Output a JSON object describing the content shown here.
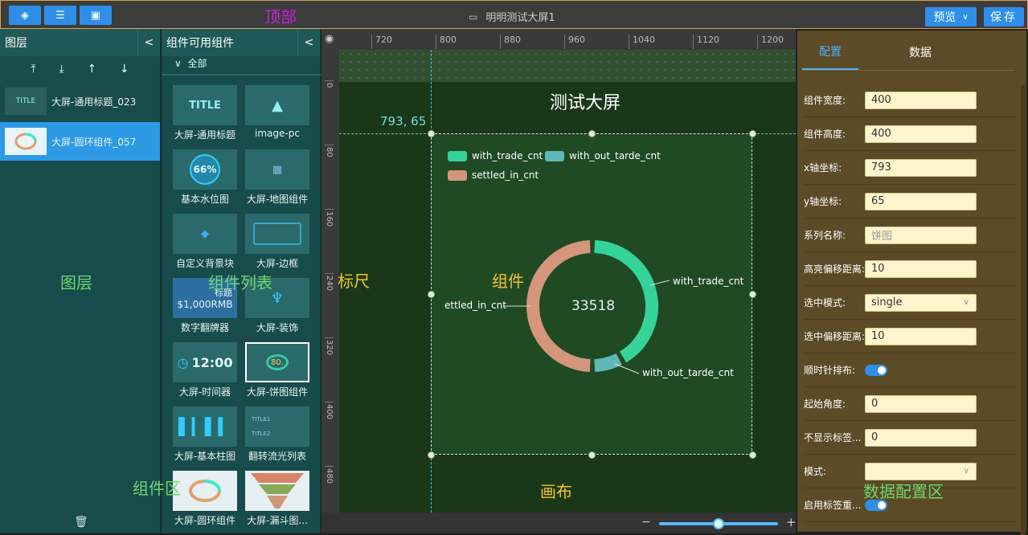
{
  "topbar": {
    "title": "明明测试大屏1",
    "preview": "预览",
    "save": "保存",
    "annotation": "顶部"
  },
  "layers": {
    "title": "图层",
    "items": [
      "大屏-通用标题_023",
      "大屏-圆环组件_057"
    ],
    "annotation": "图层",
    "thumb_title": "TITLE"
  },
  "components": {
    "title": "组件可用组件",
    "group": "全部",
    "annotation_list": "组件列表",
    "annotation_area": "组件区",
    "items": [
      {
        "label": "大屏-通用标题",
        "thumb": "TITLE"
      },
      {
        "label": "image-pc",
        "thumb": ""
      },
      {
        "label": "基本水位图",
        "thumb": "66%"
      },
      {
        "label": "大屏-地图组件",
        "thumb": ""
      },
      {
        "label": "自定义背景块",
        "thumb": ""
      },
      {
        "label": "大屏-边框",
        "thumb": ""
      },
      {
        "label": "数字翻牌器",
        "thumb": "$1,000RMB",
        "thumb_small": "标题"
      },
      {
        "label": "大屏-装饰",
        "thumb": ""
      },
      {
        "label": "大屏-时间器",
        "thumb": "12:00"
      },
      {
        "label": "大屏-饼图组件",
        "thumb": "80."
      },
      {
        "label": "大屏-基本柱图",
        "thumb": ""
      },
      {
        "label": "翻转流光列表",
        "thumb": "TITLE1",
        "thumb_small": "TITLE2"
      },
      {
        "label": "大屏-圆环组件",
        "thumb": ""
      },
      {
        "label": "大屏-漏斗图...",
        "thumb": ""
      }
    ]
  },
  "ruler": {
    "top_ticks": [
      "720",
      "800",
      "880",
      "960",
      "1040",
      "1120",
      "1200"
    ],
    "left_ticks": [
      "0",
      "80",
      "160",
      "240",
      "320",
      "400",
      "480"
    ],
    "annotation": "标尺"
  },
  "canvas": {
    "title": "测试大屏",
    "coords": "793, 65",
    "annotation_component": "组件",
    "annotation_canvas": "画布"
  },
  "chart_data": {
    "type": "pie",
    "donut": true,
    "center_value": "33518",
    "legend_position": "top-left",
    "series": [
      {
        "name": "with_trade_cnt",
        "color": "#34d399"
      },
      {
        "name": "with_out_tarde_cnt",
        "color": "#5fb8b8"
      },
      {
        "name": "settled_in_cnt",
        "color": "#d4957a"
      }
    ],
    "labels": [
      "with_trade_cnt",
      "with_out_tarde_cnt",
      "ettled_in_cnt"
    ]
  },
  "zoom": {
    "minus": "−",
    "plus": "+",
    "level": 0.5
  },
  "props": {
    "tab_config": "配置",
    "tab_data": "数据",
    "annotation": "数据配置区",
    "rows": [
      {
        "label": "组件宽度:",
        "value": "400"
      },
      {
        "label": "组件高度:",
        "value": "400"
      },
      {
        "label": "x轴坐标:",
        "value": "793"
      },
      {
        "label": "y轴坐标:",
        "value": "65"
      },
      {
        "label": "系列名称:",
        "placeholder": "饼图"
      },
      {
        "label": "高亮偏移距离:",
        "value": "10"
      },
      {
        "label": "选中模式:",
        "value": "single"
      },
      {
        "label": "选中偏移距离:",
        "value": "10"
      },
      {
        "label": "顺时针排布:"
      },
      {
        "label": "起始角度:",
        "value": "0"
      },
      {
        "label": "不显示标签...",
        "value": "0"
      },
      {
        "label": "模式:",
        "value": ""
      },
      {
        "label": "启用标签重..."
      }
    ]
  }
}
